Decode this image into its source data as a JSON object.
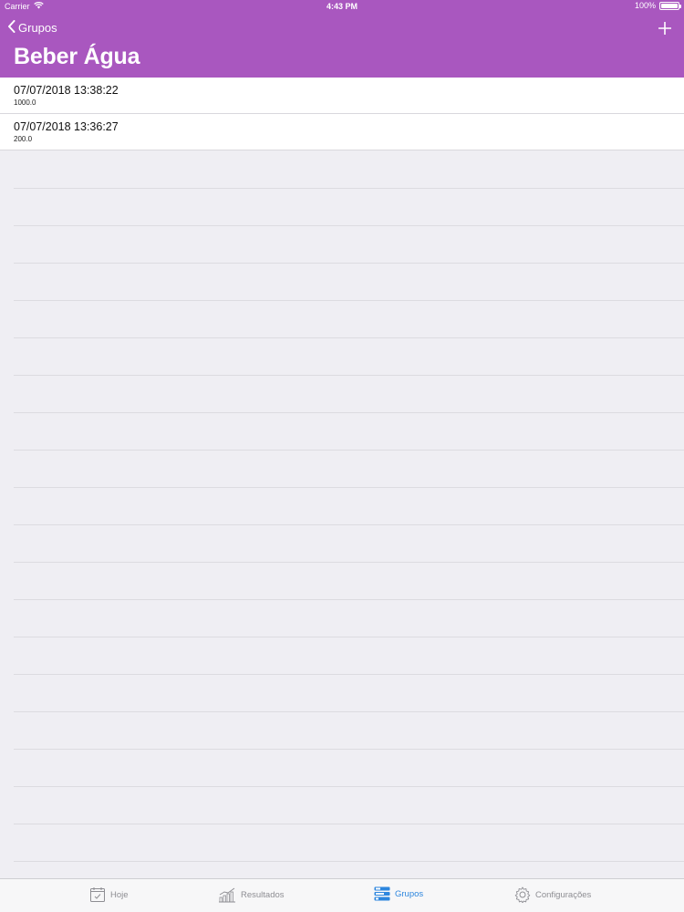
{
  "status_bar": {
    "carrier": "Carrier",
    "time": "4:43 PM",
    "battery": "100%",
    "battery_level": 1.0
  },
  "nav": {
    "back_label": "Grupos",
    "title": "Beber Água",
    "add_icon": "plus-icon"
  },
  "entries": [
    {
      "datetime": "07/07/2018 13:38:22",
      "value": "1000.0"
    },
    {
      "datetime": "07/07/2018 13:36:27",
      "value": "200.0"
    }
  ],
  "tabs": [
    {
      "label": "Hoje",
      "icon": "calendar-check-icon",
      "active": false
    },
    {
      "label": "Resultados",
      "icon": "chart-icon",
      "active": false
    },
    {
      "label": "Grupos",
      "icon": "groups-icon",
      "active": true
    },
    {
      "label": "Configurações",
      "icon": "gear-icon",
      "active": false
    }
  ],
  "colors": {
    "header": "#a957bf",
    "active_tab": "#2d86de",
    "inactive_tab": "#8e8e93",
    "background": "#efeef3"
  }
}
